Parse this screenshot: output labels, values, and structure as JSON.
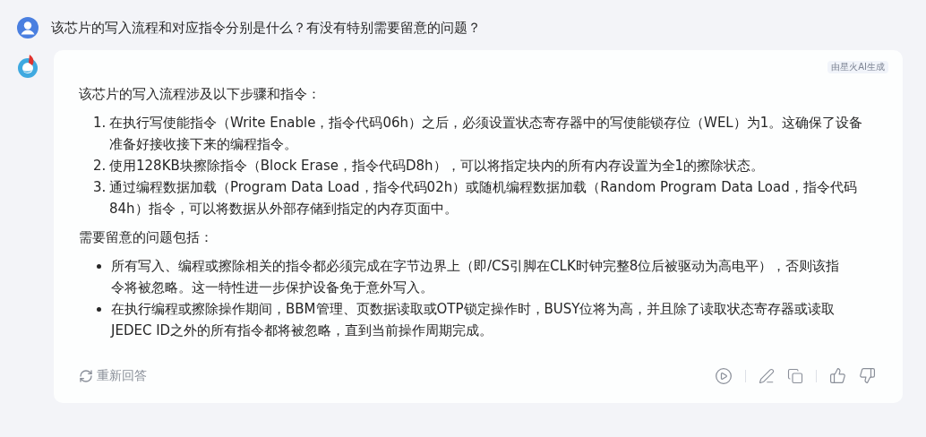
{
  "question": {
    "text": "该芯片的写入流程和对应指令分别是什么？有没有特别需要留意的问题？"
  },
  "answer": {
    "badge": "由星火AI生成",
    "intro": "该芯片的写入流程涉及以下步骤和指令：",
    "steps": [
      {
        "number": "1.",
        "text": "在执行写使能指令（Write Enable，指令代码06h）之后，必须设置状态寄存器中的写使能锁存位（WEL）为1。这确保了设备准备好接收接下来的编程指令。"
      },
      {
        "number": "2.",
        "text": "使用128KB块擦除指令（Block Erase，指令代码D8h），可以将指定块内的所有内存设置为全1的擦除状态。"
      },
      {
        "number": "3.",
        "text": "通过编程数据加载（Program Data Load，指令代码02h）或随机编程数据加载（Random Program Data Load，指令代码84h）指令，可以将数据从外部存储到指定的内存页面中。"
      }
    ],
    "notes_heading": "需要留意的问题包括：",
    "notes": [
      "所有写入、编程或擦除相关的指令都必须完成在字节边界上（即/CS引脚在CLK时钟完整8位后被驱动为高电平），否则该指令将被忽略。这一特性进一步保护设备免于意外写入。",
      "在执行编程或擦除操作期间，BBM管理、页数据读取或OTP锁定操作时，BUSY位将为高，并且除了读取状态寄存器或读取JEDEC ID之外的所有指令都将被忽略，直到当前操作周期完成。"
    ],
    "regenerate": "重新回答"
  }
}
